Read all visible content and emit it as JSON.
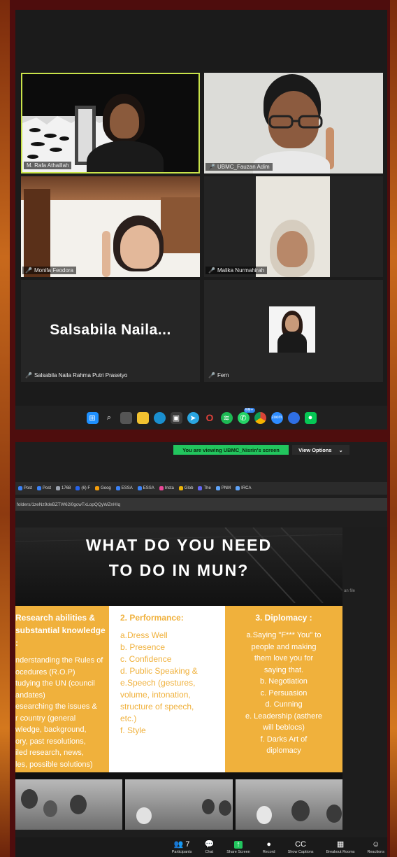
{
  "top": {
    "participants": [
      {
        "name": "M. Rafa Athaillah"
      },
      {
        "name": "UBMC_Fauzan Adim"
      },
      {
        "name": "Monifa Feodora"
      },
      {
        "name": "Malika Nurmahirah"
      },
      {
        "name": "Salsabila Naila Rahma Putri Prasetyo",
        "display": "Salsabila  Naila..."
      },
      {
        "name": "Fern"
      }
    ],
    "taskbar_badge": "99+"
  },
  "bottom": {
    "banner": "You are viewing UBMC_Nisrin's screen",
    "view_options": "View Options",
    "view_options_caret": "⌄",
    "bookmarks": [
      {
        "label": "Post",
        "color": "#3b82f6"
      },
      {
        "label": "Post",
        "color": "#3b82f6"
      },
      {
        "label": "1768",
        "color": "#9ca3af"
      },
      {
        "label": "(6) F",
        "color": "#2563eb"
      },
      {
        "label": "Goog",
        "color": "#f59e0b"
      },
      {
        "label": "ESSA",
        "color": "#3b82f6"
      },
      {
        "label": "ESSA",
        "color": "#3b82f6"
      },
      {
        "label": "Insta",
        "color": "#ec4899"
      },
      {
        "label": "Glob",
        "color": "#eab308"
      },
      {
        "label": "The",
        "color": "#6366f1"
      },
      {
        "label": "PNM",
        "color": "#60a5fa"
      },
      {
        "label": "IRCA",
        "color": "#60a5fa"
      }
    ],
    "url": "folders/1zeNz9deBZTW62i0gcwTxLopQQyWZnHIq",
    "side_text": "an file",
    "slide": {
      "title_line1": "WHAT DO YOU NEED",
      "title_line2": "TO DO IN MUN?",
      "col1": {
        "title": "Research abilities &\nsubstantial knowledge :",
        "items": [
          "nderstanding the Rules of",
          "ocedures (R.O.P)",
          "tudying the UN (council",
          "andates)",
          "esearching the issues &",
          "r country (general",
          "wledge, background,",
          "ory, past resolutions,",
          "iled research, news,",
          "les, possible solutions)"
        ]
      },
      "col2": {
        "title": "2. Performance:",
        "items": [
          "a.Dress Well",
          "b. Presence",
          "c. Confidence",
          "d. Public Speaking &",
          "e.Speech  (gestures,",
          "volume,  intonation,",
          "structure of speech,",
          "etc.)",
          "f. Style"
        ]
      },
      "col3": {
        "title": "3. Diplomacy :",
        "items": [
          "a.Saying \"F*** You\" to",
          "people and making",
          "them love you for",
          "saying that.",
          "b. Negotiation",
          "c. Persuasion",
          "d. Cunning",
          "e. Leadership (asthere",
          "will beblocs)",
          "f. Darks Art of",
          "diplomacy"
        ]
      }
    },
    "toolbar": [
      {
        "icon": "👥",
        "label": "Participants",
        "count": "7"
      },
      {
        "icon": "💬",
        "label": "Chat"
      },
      {
        "icon": "↑",
        "label": "Share Screen"
      },
      {
        "icon": "●",
        "label": "Record"
      },
      {
        "icon": "CC",
        "label": "Show Captions"
      },
      {
        "icon": "▦",
        "label": "Breakout Rooms"
      },
      {
        "icon": "☺",
        "label": "Reactions"
      }
    ]
  },
  "colors": {
    "frame_bg": "#4e0d0d",
    "zoom_green": "#22c55e",
    "slide_yellow": "#f0b13c",
    "mic_muted": "#e0413a",
    "active_speaker_border": "#c9e34a"
  }
}
